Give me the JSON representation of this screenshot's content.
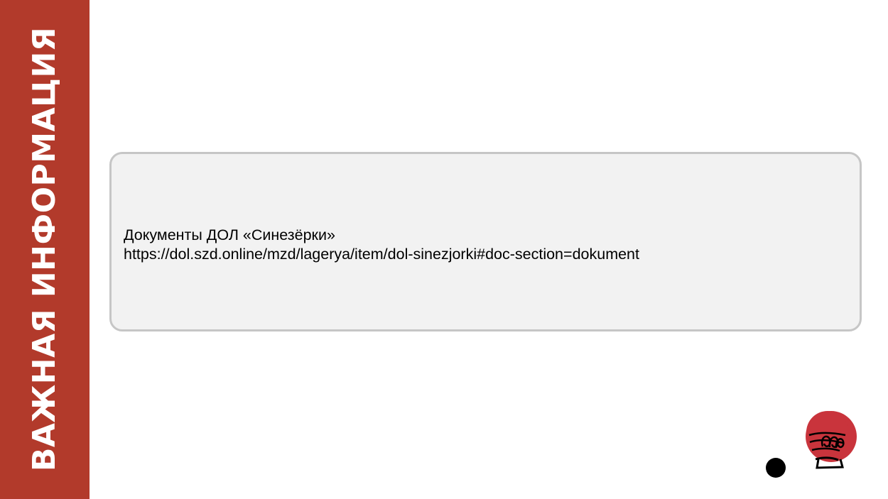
{
  "sidebar": {
    "title": "ВАЖНАЯ ИНФОРМАЦИЯ"
  },
  "info": {
    "title": "Документы ДОЛ «Синезёрки»",
    "url": "https://dol.szd.online/mzd/lagerya/item/dol-sinezjorki#doc-section=dokument"
  },
  "decoration": {
    "icon": "chef-hat-icon",
    "dot": "black-dot"
  },
  "colors": {
    "accent": "#b23a2b",
    "box_background": "#f2f2f2",
    "box_border": "#c6c6c6",
    "hat_red": "#c9343c"
  }
}
